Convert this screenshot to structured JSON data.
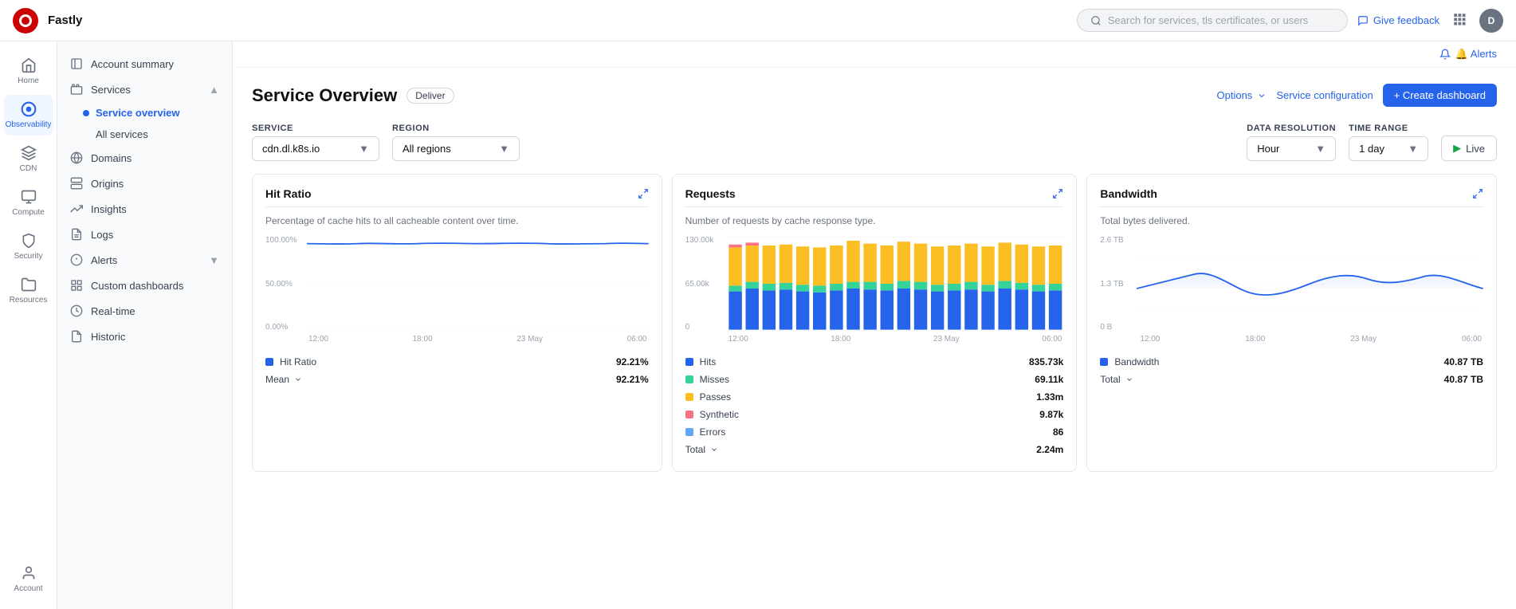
{
  "app": {
    "brand": "Fastly",
    "logo_alt": "Fastly logo"
  },
  "topnav": {
    "search_placeholder": "Search for services, tls certificates, or users",
    "feedback_label": "Give feedback",
    "user_avatar": "D"
  },
  "icon_sidebar": {
    "items": [
      {
        "id": "home",
        "label": "Home",
        "icon": "home"
      },
      {
        "id": "observability",
        "label": "Observability",
        "icon": "observability",
        "active": true
      },
      {
        "id": "cdn",
        "label": "CDN",
        "icon": "cdn"
      },
      {
        "id": "compute",
        "label": "Compute",
        "icon": "compute"
      },
      {
        "id": "security",
        "label": "Security",
        "icon": "security"
      },
      {
        "id": "resources",
        "label": "Resources",
        "icon": "resources"
      },
      {
        "id": "account",
        "label": "Account",
        "icon": "account"
      }
    ]
  },
  "secondary_sidebar": {
    "items": [
      {
        "id": "account-summary",
        "label": "Account summary",
        "icon": "summary",
        "indent": 0
      },
      {
        "id": "services",
        "label": "Services",
        "icon": "services",
        "indent": 0,
        "expanded": true
      },
      {
        "id": "service-overview",
        "label": "Service overview",
        "indent": 1,
        "active": true,
        "dot": true
      },
      {
        "id": "all-services",
        "label": "All services",
        "indent": 1,
        "dot": false
      },
      {
        "id": "domains",
        "label": "Domains",
        "icon": "domains",
        "indent": 0
      },
      {
        "id": "origins",
        "label": "Origins",
        "icon": "origins",
        "indent": 0
      },
      {
        "id": "insights",
        "label": "Insights",
        "icon": "insights",
        "indent": 0
      },
      {
        "id": "logs",
        "label": "Logs",
        "icon": "logs",
        "indent": 0
      },
      {
        "id": "alerts",
        "label": "Alerts",
        "icon": "alerts",
        "indent": 0,
        "expanded": true
      },
      {
        "id": "custom-dashboards",
        "label": "Custom dashboards",
        "icon": "dashboards",
        "indent": 0
      },
      {
        "id": "real-time",
        "label": "Real-time",
        "icon": "realtime",
        "indent": 0
      },
      {
        "id": "historic",
        "label": "Historic",
        "icon": "historic",
        "indent": 0
      }
    ]
  },
  "alerts_bar": {
    "label": "🔔 Alerts"
  },
  "page": {
    "title": "Service Overview",
    "badge": "Deliver",
    "options_label": "Options",
    "service_config_label": "Service configuration",
    "create_dashboard_label": "+ Create dashboard"
  },
  "filters": {
    "service_label": "Service",
    "service_value": "cdn.dl.k8s.io",
    "region_label": "Region",
    "region_value": "All regions",
    "data_resolution_label": "Data Resolution",
    "data_resolution_value": "Hour",
    "time_range_label": "Time Range",
    "time_range_value": "1 day",
    "live_label": "Live"
  },
  "charts": {
    "hit_ratio": {
      "title": "Hit Ratio",
      "description": "Percentage of cache hits to all cacheable content over time.",
      "y_labels": [
        "100.00%",
        "50.00%",
        "0.00%"
      ],
      "x_labels": [
        "12:00",
        "18:00",
        "23 May",
        "06:00"
      ],
      "legend": [
        {
          "color": "#2563eb",
          "label": "Hit Ratio",
          "value": "92.21%"
        }
      ],
      "sub_legend": [
        {
          "label": "Mean",
          "value": "92.21%"
        }
      ]
    },
    "requests": {
      "title": "Requests",
      "description": "Number of requests by cache response type.",
      "y_labels": [
        "130.00k",
        "65.00k",
        "0"
      ],
      "x_labels": [
        "12:00",
        "18:00",
        "23 May",
        "06:00"
      ],
      "legend": [
        {
          "color": "#2563eb",
          "label": "Hits",
          "value": "835.73k"
        },
        {
          "color": "#34d399",
          "label": "Misses",
          "value": "69.11k"
        },
        {
          "color": "#fbbf24",
          "label": "Passes",
          "value": "1.33m"
        },
        {
          "color": "#fb7185",
          "label": "Synthetic",
          "value": "9.87k"
        },
        {
          "color": "#60a5fa",
          "label": "Errors",
          "value": "86"
        }
      ],
      "sub_legend": [
        {
          "label": "Total",
          "value": "2.24m"
        }
      ]
    },
    "bandwidth": {
      "title": "Bandwidth",
      "description": "Total bytes delivered.",
      "y_labels": [
        "2.6 TB",
        "1.3 TB",
        "0 B"
      ],
      "x_labels": [
        "12:00",
        "18:00",
        "23 May",
        "06:00"
      ],
      "legend": [
        {
          "color": "#2563eb",
          "label": "Bandwidth",
          "value": "40.87 TB"
        }
      ],
      "sub_legend": [
        {
          "label": "Total",
          "value": "40.87 TB"
        }
      ]
    }
  }
}
